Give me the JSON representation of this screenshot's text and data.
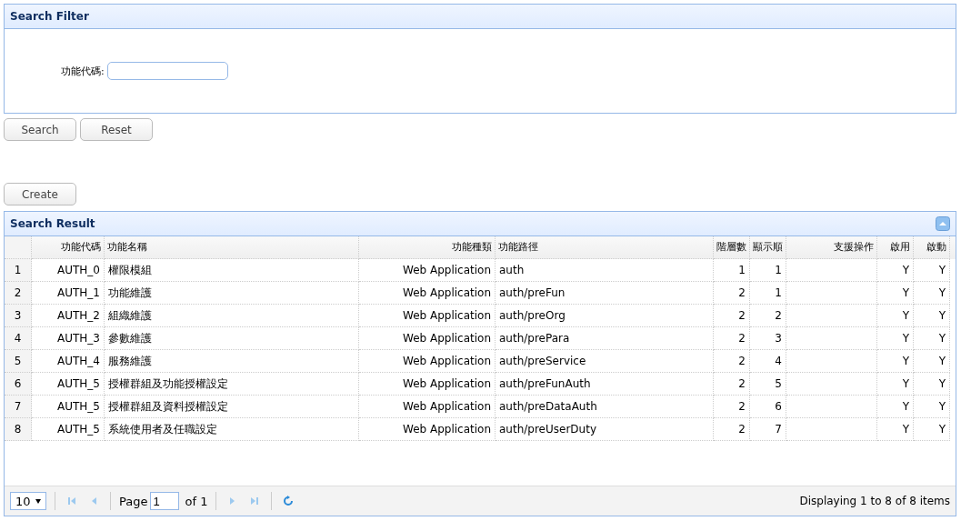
{
  "filter_panel": {
    "title": "Search Filter",
    "fields": [
      {
        "label": "功能代碼:"
      }
    ]
  },
  "filter_buttons": [
    "Search",
    "Reset"
  ],
  "create_button": "Create",
  "result_panel": {
    "title": "Search Result",
    "table": {
      "columns": [
        "功能代碼",
        "功能名稱",
        "功能種類",
        "功能路徑",
        "階層數",
        "顯示順",
        "支援操作",
        "啟用",
        "啟動"
      ],
      "rows": [
        {
          "number": "1",
          "code": "AUTH_0",
          "name": "權限模組",
          "type": "Web Application",
          "path": "auth",
          "level_no": "1",
          "order": "1",
          "enabled": "Y",
          "active": "Y"
        },
        {
          "number": "2",
          "code": "AUTH_1",
          "name": "功能維護",
          "type": "Web Application",
          "path": "auth/preFun",
          "level_no": "2",
          "order": "1",
          "enabled": "Y",
          "active": "Y"
        },
        {
          "number": "3",
          "code": "AUTH_2",
          "name": "組織維護",
          "type": "Web Application",
          "path": "auth/preOrg",
          "level_no": "2",
          "order": "2",
          "enabled": "Y",
          "active": "Y"
        },
        {
          "number": "4",
          "code": "AUTH_3",
          "name": "參數維護",
          "type": "Web Application",
          "path": "auth/prePara",
          "level_no": "2",
          "order": "3",
          "enabled": "Y",
          "active": "Y"
        },
        {
          "number": "5",
          "code": "AUTH_4",
          "name": "服務維護",
          "type": "Web Application",
          "path": "auth/preService",
          "level_no": "2",
          "order": "4",
          "enabled": "Y",
          "active": "Y"
        },
        {
          "number": "6",
          "code": "AUTH_5",
          "name": "授權群組及功能授權設定",
          "type": "Web Application",
          "path": "auth/preFunAuth",
          "level_no": "2",
          "order": "5",
          "enabled": "Y",
          "active": "Y"
        },
        {
          "number": "7",
          "code": "AUTH_5",
          "name": "授權群組及資料授權設定",
          "type": "Web Application",
          "path": "auth/preDataAuth",
          "level_no": "2",
          "order": "6",
          "enabled": "Y",
          "active": "Y"
        },
        {
          "number": "8",
          "code": "AUTH_5",
          "name": "系統使用者及任職設定",
          "type": "Web Application",
          "path": "auth/preUserDuty",
          "level_no": "2",
          "order": "7",
          "enabled": "Y",
          "active": "Y"
        }
      ]
    },
    "pager": {
      "page_size": "10",
      "page_label": "Page",
      "page": "1",
      "of": "of 1",
      "summary": "Displaying 1 to 8 of 8 items"
    }
  }
}
